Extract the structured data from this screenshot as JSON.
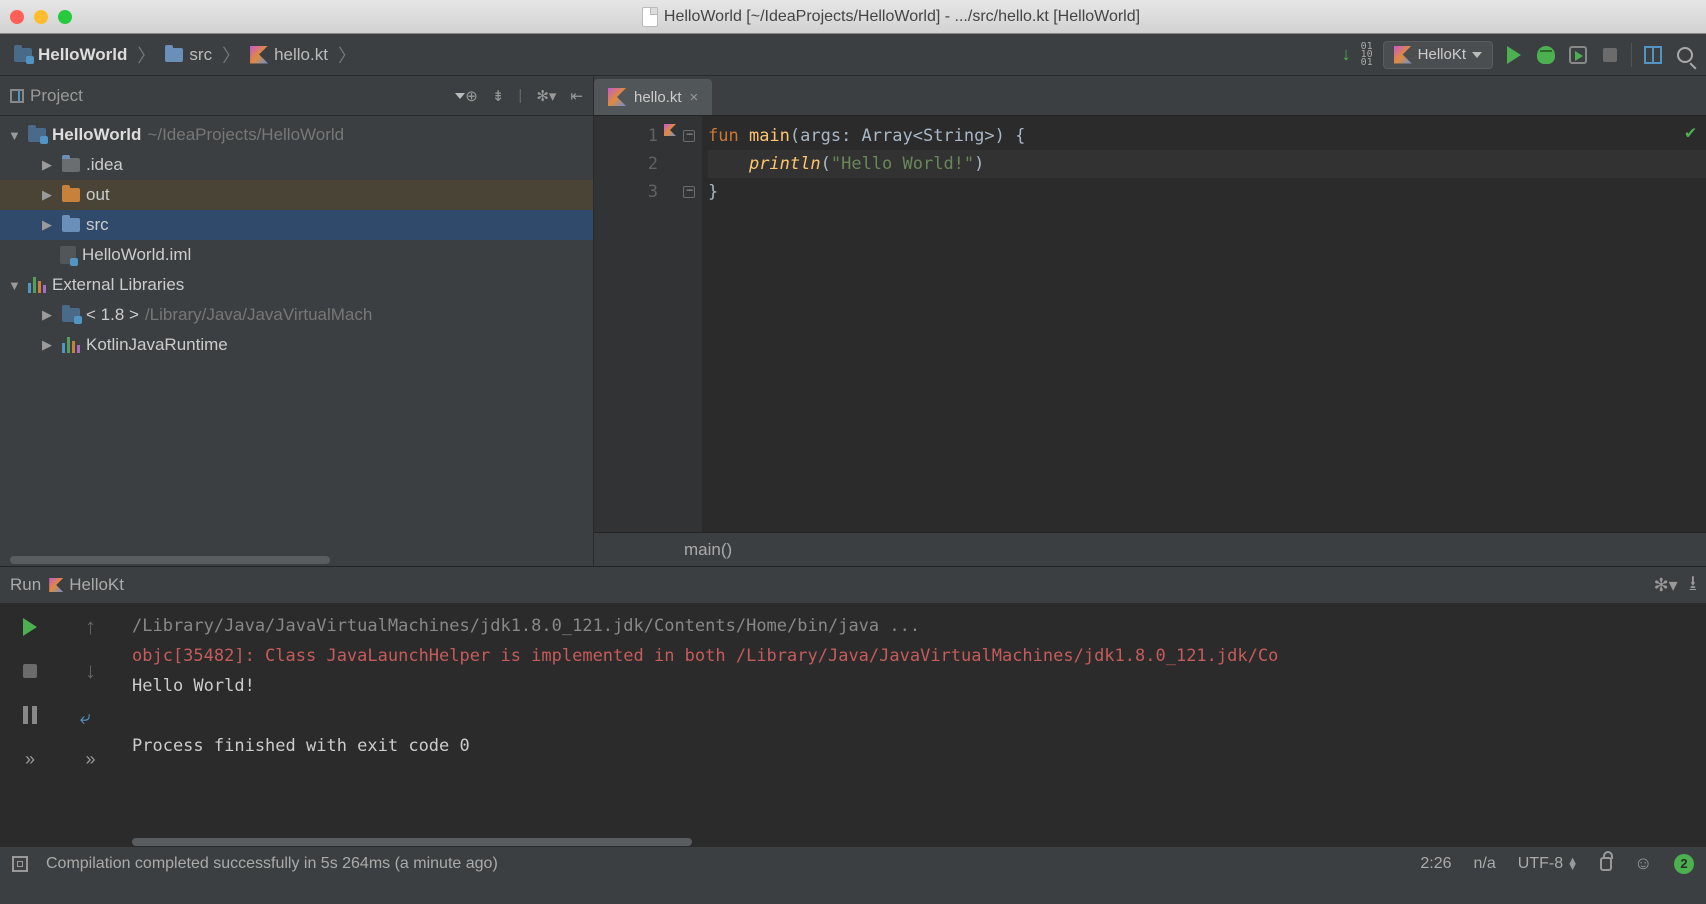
{
  "window": {
    "title": "HelloWorld [~/IdeaProjects/HelloWorld] - .../src/hello.kt [HelloWorld]"
  },
  "breadcrumbs": {
    "project": "HelloWorld",
    "folder": "src",
    "file": "hello.kt"
  },
  "toolbar": {
    "run_config": "HelloKt"
  },
  "project_panel": {
    "title": "Project",
    "root": {
      "name": "HelloWorld",
      "path": "~/IdeaProjects/HelloWorld"
    },
    "items": [
      {
        "name": ".idea"
      },
      {
        "name": "out"
      },
      {
        "name": "src"
      },
      {
        "name": "HelloWorld.iml"
      }
    ],
    "external": {
      "label": "External Libraries"
    },
    "libs": [
      {
        "name": "< 1.8 >",
        "path": "/Library/Java/JavaVirtualMach"
      },
      {
        "name": "KotlinJavaRuntime"
      }
    ]
  },
  "editor": {
    "tab": "hello.kt",
    "crumb": "main()",
    "code": {
      "l1_kw": "fun ",
      "l1_fn": "main",
      "l1_rest": "(args: Array<String>) {",
      "l2_indent": "    ",
      "l2_fn": "println",
      "l2_open": "(",
      "l2_str": "\"Hello World!\"",
      "l2_close": ")",
      "l3": "}"
    },
    "line_numbers": [
      "1",
      "2",
      "3"
    ]
  },
  "run": {
    "title_prefix": "Run",
    "title_config": "HelloKt",
    "console": {
      "cmd": "/Library/Java/JavaVirtualMachines/jdk1.8.0_121.jdk/Contents/Home/bin/java ...",
      "warn": "objc[35482]: Class JavaLaunchHelper is implemented in both /Library/Java/JavaVirtualMachines/jdk1.8.0_121.jdk/Co",
      "out": "Hello World!",
      "exit": "Process finished with exit code 0"
    }
  },
  "status": {
    "msg": "Compilation completed successfully in 5s 264ms (a minute ago)",
    "pos": "2:26",
    "sep": "n/a",
    "enc": "UTF-8",
    "badge": "2"
  }
}
